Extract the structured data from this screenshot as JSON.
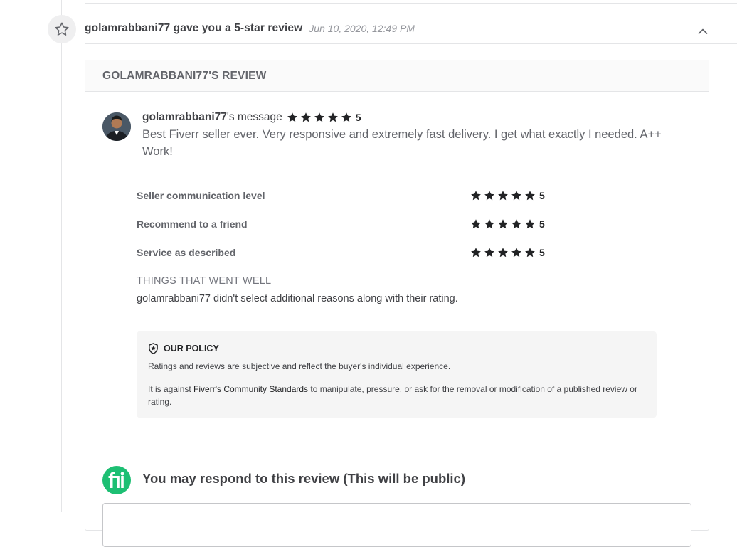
{
  "event": {
    "title": "golamrabbani77 gave you a 5-star review",
    "date": "Jun 10, 2020, 12:49 PM",
    "icon": "star-outline-icon",
    "collapse_icon": "chevron-up-icon"
  },
  "review": {
    "card_title": "GOLAMRABBANI77'S REVIEW",
    "author": "golamrabbani77",
    "author_suffix": "'s message",
    "overall_rating": "5",
    "message": "Best Fiverr seller ever. Very responsive and extremely fast delivery. I get what exactly I needed. A++ Work!",
    "criteria": [
      {
        "label": "Seller communication level",
        "value": "5"
      },
      {
        "label": "Recommend to a friend",
        "value": "5"
      },
      {
        "label": "Service as described",
        "value": "5"
      }
    ],
    "went_well_title": "THINGS THAT WENT WELL",
    "went_well_text": "golamrabbani77 didn't select additional reasons along with their rating."
  },
  "policy": {
    "icon": "shield-icon",
    "title": "OUR POLICY",
    "p1": "Ratings and reviews are subjective and reflect the buyer's individual experience.",
    "p2_before": "It is against ",
    "p2_link": "Fiverr's Community Standards",
    "p2_after": " to manipulate, pressure, or ask for the removal or modification of a published review or rating."
  },
  "respond": {
    "logo": "fiverr-logo",
    "title": "You may respond to this review (This will be public)"
  },
  "colors": {
    "brand_green": "#1dbf73",
    "star": "#222325",
    "text": "#404145",
    "muted": "#62646a"
  }
}
